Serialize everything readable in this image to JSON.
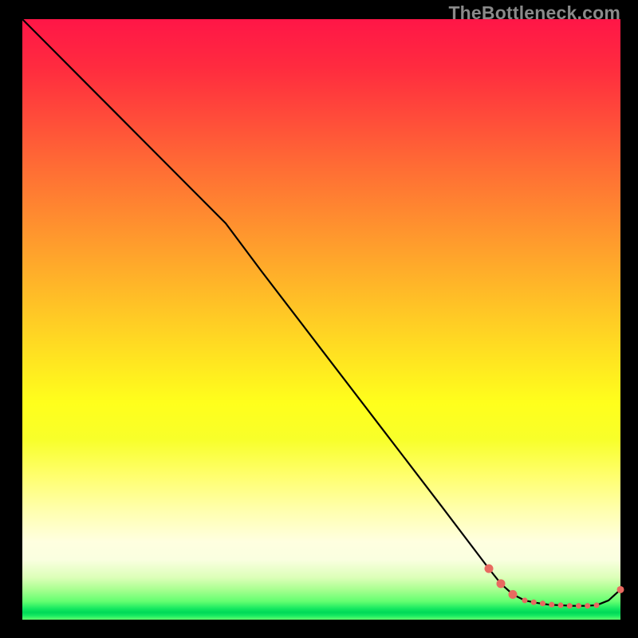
{
  "watermark": "TheBottleneck.com",
  "chart_data": {
    "type": "line",
    "title": "",
    "xlabel": "",
    "ylabel": "",
    "xlim": [
      0,
      100
    ],
    "ylim": [
      0,
      100
    ],
    "grid": false,
    "legend": false,
    "series": [
      {
        "name": "curve",
        "x": [
          0,
          5,
          10,
          15,
          20,
          25,
          28,
          30,
          34,
          40,
          50,
          60,
          70,
          78,
          80,
          82,
          84,
          86,
          88,
          90,
          92,
          94,
          96,
          98,
          100
        ],
        "y": [
          100,
          95,
          90,
          85,
          80,
          75,
          72,
          70,
          66,
          58,
          45,
          32,
          19,
          8.5,
          6,
          4.2,
          3.2,
          2.8,
          2.5,
          2.4,
          2.3,
          2.3,
          2.4,
          3.2,
          5
        ]
      }
    ],
    "markers": [
      {
        "x": 78,
        "y": 8.5,
        "r": 5.5
      },
      {
        "x": 80,
        "y": 6.0,
        "r": 5.5
      },
      {
        "x": 82,
        "y": 4.2,
        "r": 5.5
      },
      {
        "x": 84,
        "y": 3.2,
        "r": 3.5
      },
      {
        "x": 85.5,
        "y": 2.9,
        "r": 3.5
      },
      {
        "x": 87,
        "y": 2.7,
        "r": 3.5
      },
      {
        "x": 88.5,
        "y": 2.5,
        "r": 3.5
      },
      {
        "x": 90,
        "y": 2.4,
        "r": 3.5
      },
      {
        "x": 91.5,
        "y": 2.3,
        "r": 3.5
      },
      {
        "x": 93,
        "y": 2.3,
        "r": 3.5
      },
      {
        "x": 94.5,
        "y": 2.3,
        "r": 3.5
      },
      {
        "x": 96,
        "y": 2.4,
        "r": 3.5
      },
      {
        "x": 100,
        "y": 5.0,
        "r": 4.5
      }
    ],
    "colors": {
      "marker": "#e86a60",
      "line": "#000000"
    }
  }
}
